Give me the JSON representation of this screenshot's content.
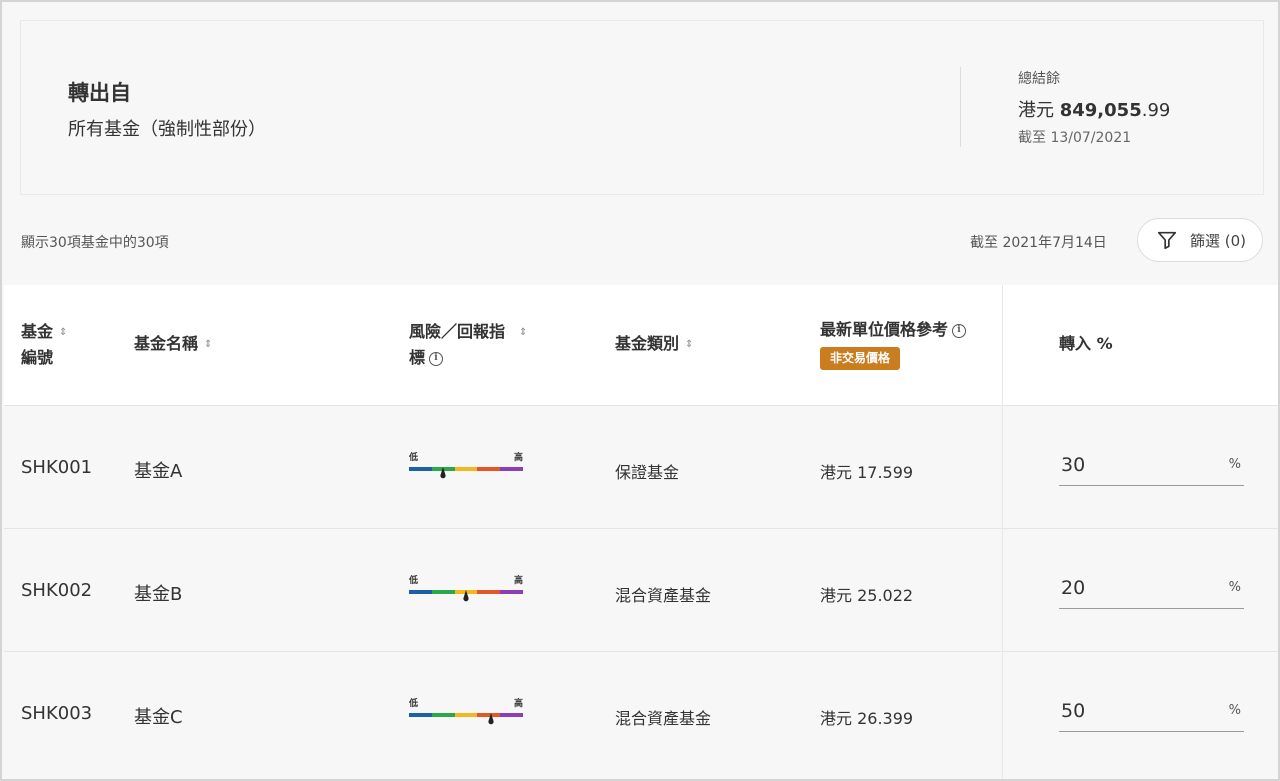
{
  "summary": {
    "title": "轉出自",
    "subtitle": "所有基金（強制性部份）",
    "balance_label": "總結餘",
    "balance_currency": "港元",
    "balance_main": "849,055",
    "balance_cents": ".99",
    "balance_date": "截至 13/07/2021"
  },
  "toolbar": {
    "showing_text": "顯示30項基金中的30項",
    "as_of_text": "截至 2021年7月14日",
    "filter_label": "篩選 (0)"
  },
  "table": {
    "headers": {
      "code_line1": "基金",
      "code_line2": "編號",
      "name": "基金名稱",
      "risk_line1": "風險／回報指",
      "risk_line2": "標",
      "category": "基金類別",
      "price": "最新單位價格參考",
      "price_badge": "非交易價格",
      "transfer": "轉入 %"
    },
    "risk_low_label": "低",
    "risk_high_label": "高",
    "percent_symbol": "%",
    "risk_colors": [
      "#1f5fa8",
      "#2aa84a",
      "#f2b81f",
      "#e2572a",
      "#8a3fb5"
    ],
    "rows": [
      {
        "code": "SHK001",
        "name": "基金A",
        "risk_level": 0.3,
        "category": "保證基金",
        "price": "港元 17.599",
        "transfer": "30"
      },
      {
        "code": "SHK002",
        "name": "基金B",
        "risk_level": 0.5,
        "category": "混合資產基金",
        "price": "港元 25.022",
        "transfer": "20"
      },
      {
        "code": "SHK003",
        "name": "基金C",
        "risk_level": 0.72,
        "category": "混合資產基金",
        "price": "港元 26.399",
        "transfer": "50"
      }
    ]
  }
}
